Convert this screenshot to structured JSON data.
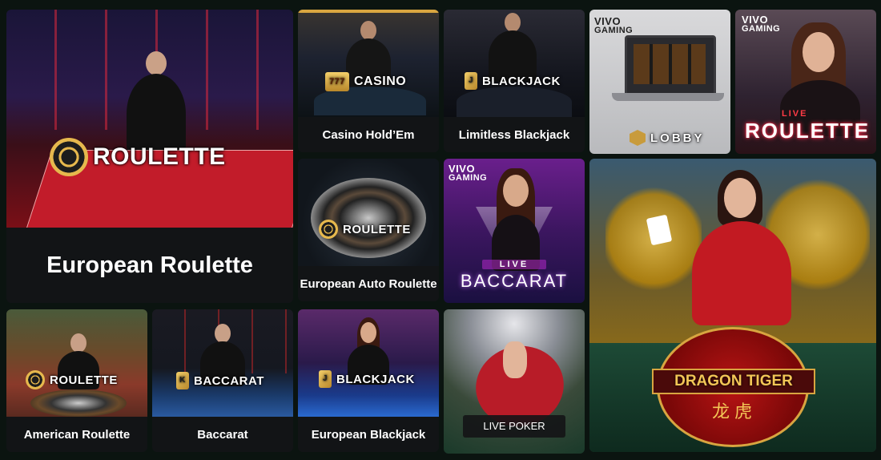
{
  "tiles": {
    "european_roulette": {
      "logo": "ROULETTE",
      "caption": "European Roulette"
    },
    "casino_holdem": {
      "logo": "CASINO",
      "icon_text": "777",
      "caption": "Casino Hold’Em"
    },
    "limitless_blackjack": {
      "logo": "BLACKJACK",
      "icon_text": "J",
      "caption": "Limitless Blackjack"
    },
    "vivo_lobby": {
      "brand_top": "VIVO",
      "brand_bottom": "GAMING",
      "lobby": "LOBBY"
    },
    "live_roulette": {
      "brand_top": "VIVO",
      "brand_bottom": "GAMING",
      "live": "LIVE",
      "title": "ROULETTE"
    },
    "european_auto_roulette": {
      "logo": "ROULETTE",
      "caption": "European Auto Roulette"
    },
    "live_baccarat": {
      "brand_top": "VIVO",
      "brand_bottom": "GAMING",
      "live": "LIVE",
      "title": "BACCARAT"
    },
    "dragon_tiger": {
      "title": "DRAGON TIGER",
      "chinese": "龙 虎"
    },
    "american_roulette": {
      "logo": "ROULETTE",
      "caption": "American Roulette"
    },
    "baccarat": {
      "logo": "BACCARAT",
      "icon_text": "K",
      "caption": "Baccarat"
    },
    "european_blackjack": {
      "logo": "BLACKJACK",
      "icon_text": "J",
      "caption": "European Blackjack"
    },
    "live_poker": {
      "label": "LIVE POKER"
    }
  },
  "colors": {
    "gold": "#e6b84d",
    "caption_bg": "#121416",
    "page_bg": "#0b1410"
  }
}
